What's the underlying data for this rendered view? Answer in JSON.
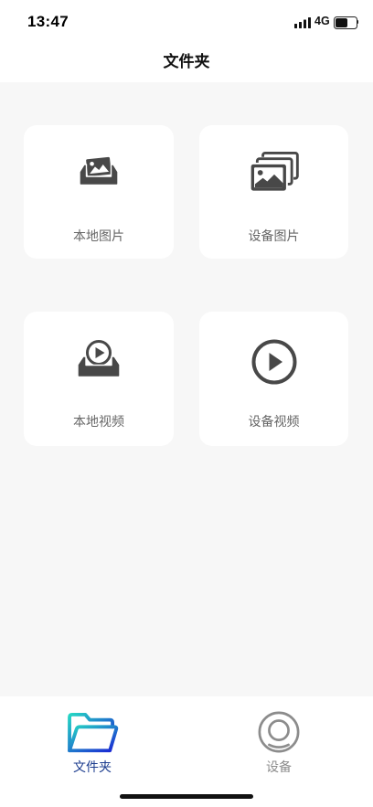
{
  "status_bar": {
    "time": "13:47",
    "network": "4G",
    "signal_icon": "signal-bars-icon",
    "battery_icon": "battery-icon",
    "battery_level": 0.6
  },
  "header": {
    "title": "文件夹"
  },
  "cards": [
    {
      "label": "本地图片",
      "icon": "local-images-icon"
    },
    {
      "label": "设备图片",
      "icon": "device-images-icon"
    },
    {
      "label": "本地视频",
      "icon": "local-videos-icon"
    },
    {
      "label": "设备视频",
      "icon": "device-videos-icon"
    }
  ],
  "tab_bar": {
    "tabs": [
      {
        "label": "文件夹",
        "icon": "folder-icon",
        "active": true
      },
      {
        "label": "设备",
        "icon": "device-icon",
        "active": false
      }
    ]
  },
  "colors": {
    "background": "#f7f7f7",
    "card": "#ffffff",
    "icon": "#484848",
    "card_label": "#666666",
    "tab_active": "#1c3c8e",
    "tab_inactive": "#8c8c8c",
    "folder_gradient_start": "#25d6c4",
    "folder_gradient_end": "#1a22d4"
  }
}
